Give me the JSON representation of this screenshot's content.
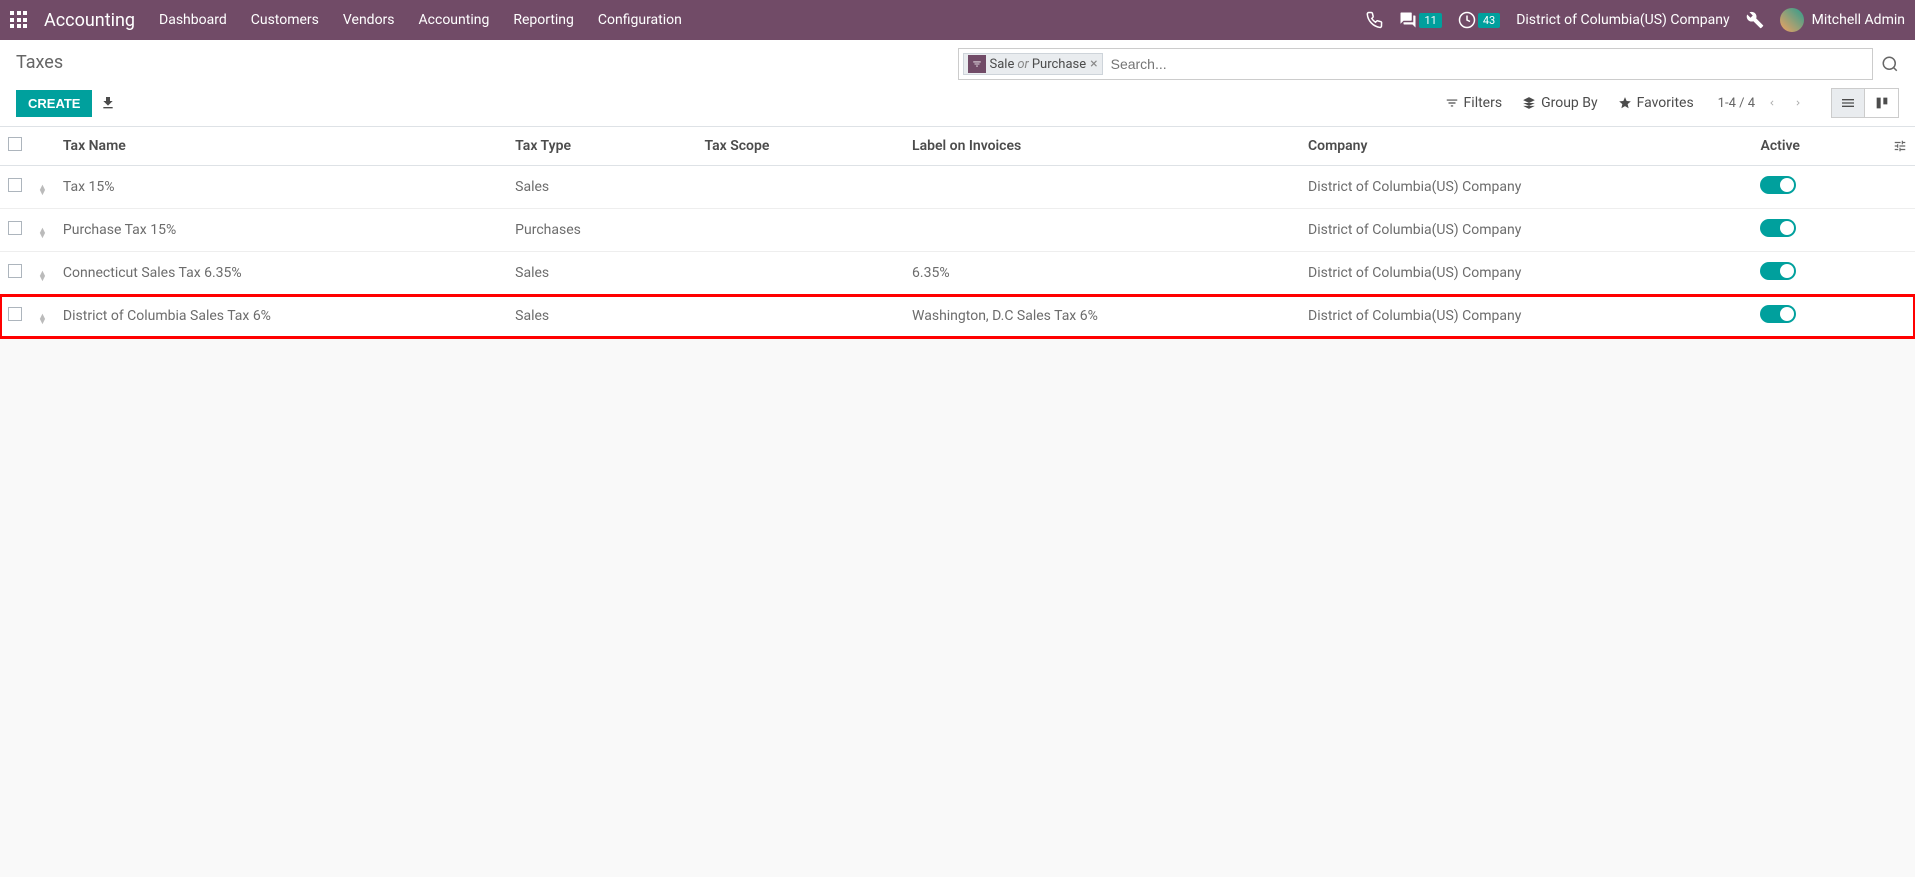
{
  "navbar": {
    "app_title": "Accounting",
    "menu": [
      "Dashboard",
      "Customers",
      "Vendors",
      "Accounting",
      "Reporting",
      "Configuration"
    ],
    "messages_badge": "11",
    "activities_badge": "43",
    "company": "District of Columbia(US) Company",
    "user_name": "Mitchell Admin"
  },
  "breadcrumb": {
    "title": "Taxes"
  },
  "buttons": {
    "create": "CREATE"
  },
  "search": {
    "filter_label_left": "Sale",
    "filter_or": "or",
    "filter_label_right": "Purchase",
    "placeholder": "Search...",
    "filters": "Filters",
    "group_by": "Group By",
    "favorites": "Favorites"
  },
  "pager": {
    "range": "1-4 / 4"
  },
  "columns": {
    "name": "Tax Name",
    "type": "Tax Type",
    "scope": "Tax Scope",
    "label": "Label on Invoices",
    "company": "Company",
    "active": "Active"
  },
  "rows": [
    {
      "name": "Tax 15%",
      "type": "Sales",
      "scope": "",
      "label": "",
      "company": "District of Columbia(US) Company",
      "active": true,
      "highlight": false
    },
    {
      "name": "Purchase Tax 15%",
      "type": "Purchases",
      "scope": "",
      "label": "",
      "company": "District of Columbia(US) Company",
      "active": true,
      "highlight": false
    },
    {
      "name": "Connecticut Sales Tax 6.35%",
      "type": "Sales",
      "scope": "",
      "label": "6.35%",
      "company": "District of Columbia(US) Company",
      "active": true,
      "highlight": false
    },
    {
      "name": "District of Columbia Sales Tax 6%",
      "type": "Sales",
      "scope": "",
      "label": "Washington, D.C Sales Tax 6%",
      "company": "District of Columbia(US) Company",
      "active": true,
      "highlight": true
    }
  ]
}
